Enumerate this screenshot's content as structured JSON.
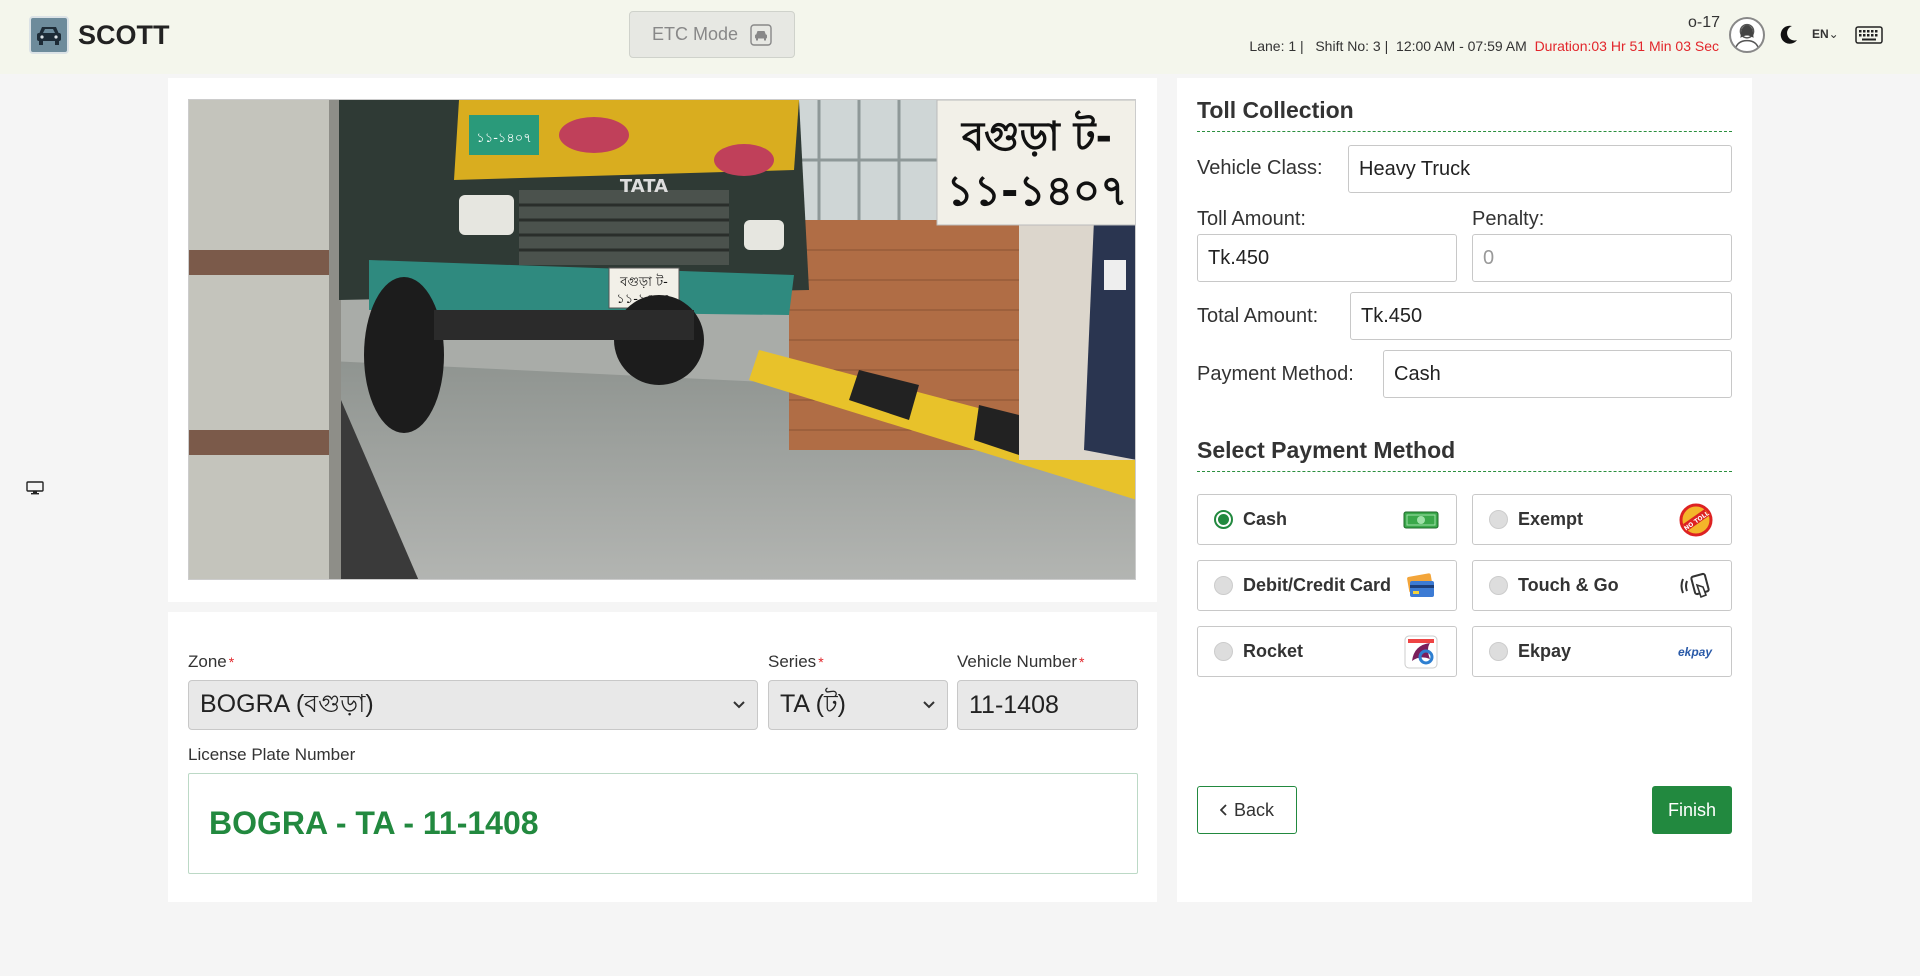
{
  "header": {
    "app_name": "SCOTT",
    "etc_mode_label": "ETC Mode",
    "operator": "o-17",
    "lane": "Lane: 1 |",
    "shift": "Shift No: 3 |",
    "time_range": "12:00 AM - 07:59 AM",
    "duration": "Duration:03 Hr 51 Min 03 Sec",
    "language": "EN"
  },
  "camera": {
    "plate_sign_line1": "বগুড়া ট-",
    "plate_sign_line2": "১১-১৪০৭",
    "truck_brand": "TATA"
  },
  "form": {
    "zone_label": "Zone",
    "zone_value": "BOGRA (বগুড়া)",
    "series_label": "Series",
    "series_value": "TA (ট)",
    "vehicle_number_label": "Vehicle Number",
    "vehicle_number_value": "11-1408",
    "required_mark": "*",
    "plate_label": "License Plate Number",
    "plate_value": "BOGRA - TA - 11-1408"
  },
  "toll": {
    "title": "Toll Collection",
    "vehicle_class_label": "Vehicle Class:",
    "vehicle_class_value": "Heavy Truck",
    "toll_amount_label": "Toll Amount:",
    "toll_amount_value": "Tk.450",
    "penalty_label": "Penalty:",
    "penalty_placeholder": "0",
    "total_amount_label": "Total Amount:",
    "total_amount_value": "Tk.450",
    "payment_method_label": "Payment Method:",
    "payment_method_value": "Cash",
    "select_title": "Select Payment Method",
    "options": [
      {
        "label": "Cash",
        "icon": "cash-icon",
        "selected": true
      },
      {
        "label": "Exempt",
        "icon": "exempt-icon",
        "selected": false
      },
      {
        "label": "Debit/Credit Card",
        "icon": "card-icon",
        "selected": false
      },
      {
        "label": "Touch & Go",
        "icon": "touch-go-icon",
        "selected": false
      },
      {
        "label": "Rocket",
        "icon": "rocket-icon",
        "selected": false
      },
      {
        "label": "Ekpay",
        "icon": "ekpay-icon",
        "selected": false
      }
    ],
    "ekpay_logo_text": "ekpay",
    "exempt_stamp_text": "NO TOLL",
    "back_label": "Back",
    "finish_label": "Finish"
  },
  "colors": {
    "primary_green": "#22893f",
    "duration_red": "#e2262b",
    "header_bg": "#f4f6ec"
  }
}
